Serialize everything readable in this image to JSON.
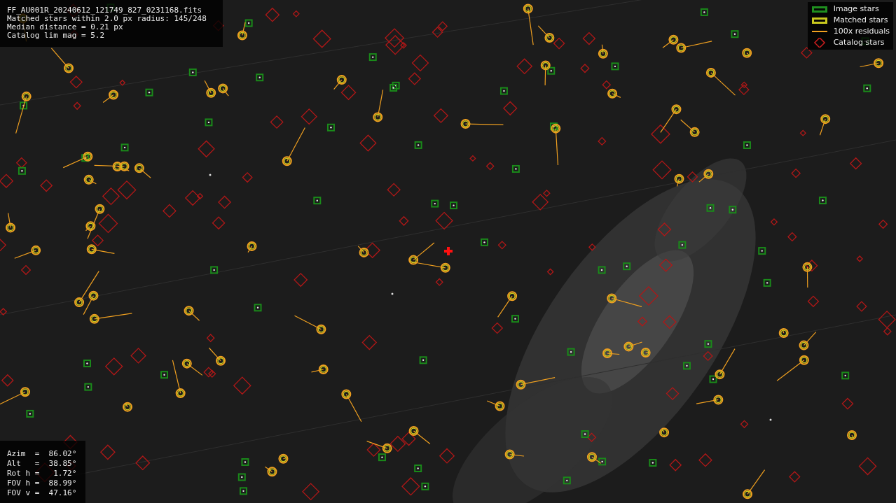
{
  "info_box": {
    "lines": [
      "FF_AU001R_20240612_121749_827_0231168.fits",
      "Matched stars within 2.0 px radius: 145/248",
      "Median distance = 0.21 px",
      "Catalog lim mag = 5.2"
    ]
  },
  "legend": [
    {
      "kind": "square",
      "color": "#1f8f1f",
      "label": "Image stars"
    },
    {
      "kind": "square",
      "color": "#c8c81e",
      "label": "Matched stars"
    },
    {
      "kind": "line",
      "color": "#f0a020",
      "label": "100x residuals"
    },
    {
      "kind": "diamond",
      "color": "#c81e1e",
      "label": "Catalog stars"
    }
  ],
  "pointing_box": {
    "lines": [
      "Azim  =  86.02°",
      "Alt   =  38.85°",
      "Rot h =   1.72°",
      "FOV h =  88.99°",
      "FOV v =  47.16°"
    ]
  }
}
